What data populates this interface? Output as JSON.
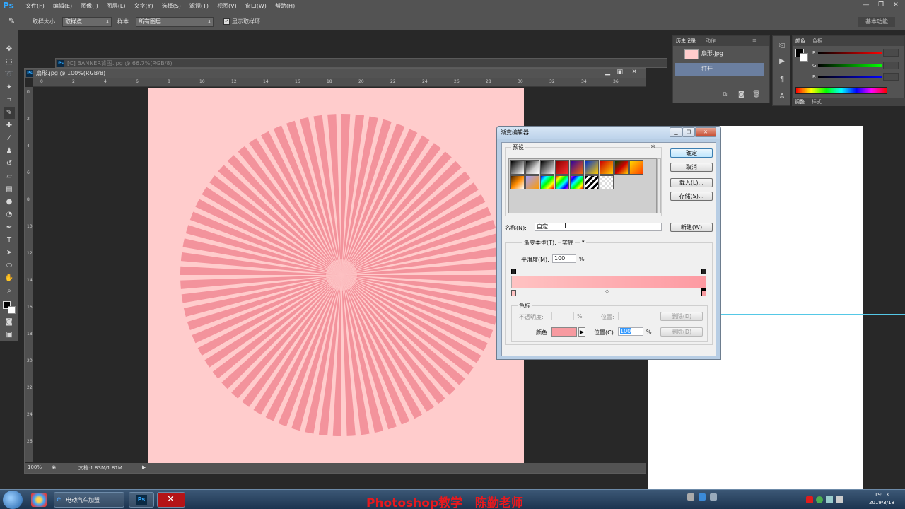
{
  "app": {
    "logo": "Ps",
    "menus": [
      "文件(F)",
      "编辑(E)",
      "图像(I)",
      "图层(L)",
      "文字(Y)",
      "选择(S)",
      "滤镜(T)",
      "视图(V)",
      "窗口(W)",
      "帮助(H)"
    ],
    "window_controls": [
      "—",
      "❐",
      "✕"
    ]
  },
  "options_bar": {
    "sample_size_label": "取样大小:",
    "sample_size_value": "取样点",
    "sample_label": "样本:",
    "sample_value": "所有图层",
    "show_ring_label": "显示取样环",
    "show_ring_checked": true,
    "workspace": "基本功能"
  },
  "documents": {
    "behind_title": "[C] BANNER背图.jpg @ 66.7%(RGB/8)",
    "main_title": "扇形.jpg @ 100%(RGB/8)",
    "zoom": "100%",
    "doc_size": "文档:1.83M/1.81M",
    "ruler_top_ticks": [
      "0",
      "2",
      "4",
      "6",
      "8",
      "10",
      "12",
      "14",
      "16",
      "18",
      "20",
      "22",
      "24",
      "26",
      "28",
      "30",
      "32",
      "34",
      "36"
    ],
    "ruler_left_ticks": [
      "0",
      "2",
      "4",
      "6",
      "8",
      "10",
      "12",
      "14",
      "16",
      "18",
      "20",
      "22",
      "24",
      "26"
    ],
    "canvas_color": "#ffcccc",
    "ray_color": "#f3939c"
  },
  "history_panel": {
    "tabs": [
      "历史记录",
      "动作"
    ],
    "snapshot_name": "扇形.jpg",
    "items": [
      "打开"
    ]
  },
  "color_panel": {
    "tabs": [
      "颜色",
      "色板"
    ],
    "channels": [
      "R",
      "G",
      "B"
    ],
    "bottom_tabs": [
      "调整",
      "样式"
    ]
  },
  "gradient_editor": {
    "title": "渐变编辑器",
    "presets_label": "预设",
    "buttons": {
      "ok": "确定",
      "cancel": "取消",
      "load": "载入(L)...",
      "save": "存储(S)...",
      "new": "新建(W)"
    },
    "name_label": "名称(N):",
    "name_value": "自定",
    "type_label": "渐变类型(T):",
    "type_value": "实底",
    "smooth_label": "平滑度(M):",
    "smooth_value": "100",
    "percent": "%",
    "stops_label": "色标",
    "opacity_label": "不透明度:",
    "location_label_1": "位置:",
    "delete_label_1": "删除(D)",
    "color_label": "颜色:",
    "location_label_2": "位置(C):",
    "location_value": "100",
    "delete_label_2": "删除(D)",
    "gradient_start": "#ffc2c2",
    "gradient_end": "#fd9aa2",
    "stop_color": "#f79aa0"
  },
  "taskbar": {
    "item_label": "电动汽车加盟",
    "ps_label": "Ps",
    "x_label": "✕",
    "caption": "Photoshop教学   陈勤老师",
    "time": "19:13",
    "date": "2019/3/18"
  }
}
